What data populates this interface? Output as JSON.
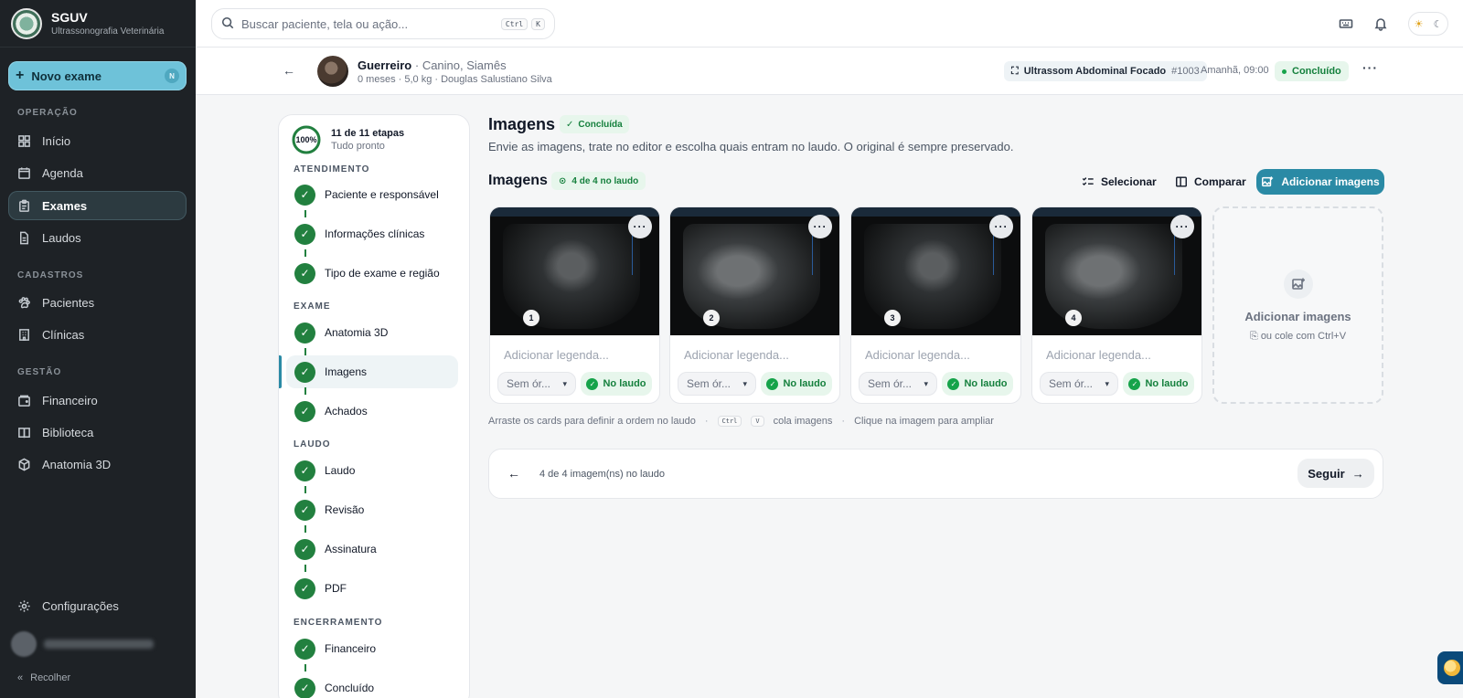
{
  "app": {
    "name": "SGUV",
    "subtitle": "Ultrassonografia Veterinária"
  },
  "sidebar": {
    "new_exam": {
      "label": "Novo exame",
      "shortcut": "N"
    },
    "sections": [
      {
        "label": "OPERAÇÃO",
        "items": [
          {
            "label": "Início",
            "icon": "grid-icon"
          },
          {
            "label": "Agenda",
            "icon": "calendar-icon"
          },
          {
            "label": "Exames",
            "icon": "clipboard-icon",
            "active": true
          },
          {
            "label": "Laudos",
            "icon": "file-icon"
          }
        ]
      },
      {
        "label": "CADASTROS",
        "items": [
          {
            "label": "Pacientes",
            "icon": "paw-icon"
          },
          {
            "label": "Clínicas",
            "icon": "building-icon"
          }
        ]
      },
      {
        "label": "GESTÃO",
        "items": [
          {
            "label": "Financeiro",
            "icon": "wallet-icon"
          },
          {
            "label": "Biblioteca",
            "icon": "book-icon"
          },
          {
            "label": "Anatomia 3D",
            "icon": "cube-icon"
          }
        ]
      }
    ],
    "settings": "Configurações",
    "collapse": "Recolher"
  },
  "search": {
    "placeholder": "Buscar paciente, tela ou ação...",
    "kbd1": "Ctrl",
    "kbd2": "K"
  },
  "patient": {
    "name": "Guerreiro",
    "species": "· Canino, Siamês",
    "meta": "0 meses · 5,0 kg · Douglas Salustiano Silva",
    "exam": "Ultrassom Abdominal Focado",
    "exam_id": "#1003",
    "when": "Amanhã, 09:00",
    "status": "Concluído"
  },
  "steps": {
    "progress": "100%",
    "progress_value": 1.0,
    "title": "11 de 11 etapas",
    "subtitle": "Tudo pronto",
    "groups": [
      {
        "label": "ATENDIMENTO",
        "items": [
          "Paciente e responsável",
          "Informações clínicas",
          "Tipo de exame e região"
        ]
      },
      {
        "label": "EXAME",
        "items": [
          "Anatomia 3D",
          "Imagens",
          "Achados"
        ]
      },
      {
        "label": "LAUDO",
        "items": [
          "Laudo",
          "Revisão",
          "Assinatura",
          "PDF"
        ]
      },
      {
        "label": "ENCERRAMENTO",
        "items": [
          "Financeiro",
          "Concluído"
        ]
      }
    ]
  },
  "main": {
    "title": "Imagens",
    "title_badge": "Concluída",
    "description": "Envie as imagens, trate no editor e escolha quais entram no laudo. O original é sempre preservado.",
    "gallery_title": "Imagens",
    "count_badge": "4  de 4 no laudo",
    "select": "Selecionar",
    "compare": "Comparar",
    "add": "Adicionar imagens",
    "cards": [
      {
        "num": "1",
        "caption": "Adicionar legenda...",
        "organ": "Sem ór...",
        "status": "No laudo"
      },
      {
        "num": "2",
        "caption": "Adicionar legenda...",
        "organ": "Sem ór...",
        "status": "No laudo"
      },
      {
        "num": "3",
        "caption": "Adicionar legenda...",
        "organ": "Sem ór...",
        "status": "No laudo"
      },
      {
        "num": "4",
        "caption": "Adicionar legenda...",
        "organ": "Sem ór...",
        "status": "No laudo"
      }
    ],
    "add_card": {
      "title": "Adicionar imagens",
      "sub": "ou cole com Ctrl+V"
    },
    "hints": {
      "drag": "Arraste os cards para definir a ordem no laudo",
      "kbd1": "Ctrl",
      "kbd2": "V",
      "paste": "cola imagens",
      "zoom": "Clique na imagem para ampliar"
    },
    "footer": {
      "info": "4 de 4 imagem(ns) no laudo",
      "next": "Seguir"
    }
  }
}
